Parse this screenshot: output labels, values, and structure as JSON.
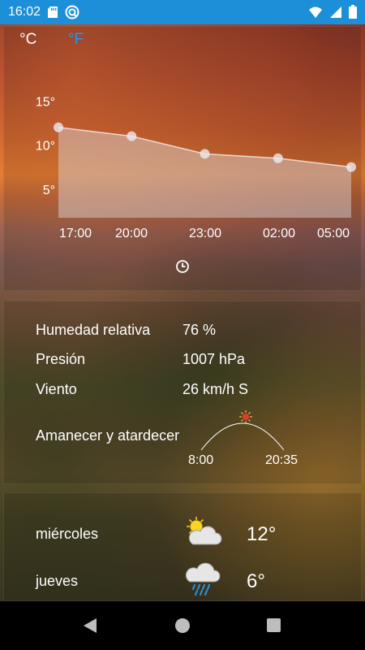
{
  "status_bar": {
    "time": "16:02"
  },
  "units": {
    "celsius": "°C",
    "fahrenheit": "°F",
    "selected": "celsius"
  },
  "chart_data": {
    "type": "area",
    "x": [
      "17:00",
      "20:00",
      "23:00",
      "02:00",
      "05:00"
    ],
    "series": [
      {
        "values": [
          12,
          11,
          9,
          8.5,
          7.5
        ]
      }
    ],
    "y_ticks": [
      "15°",
      "10°",
      "5°"
    ],
    "ylim": [
      0,
      15
    ],
    "grid": false
  },
  "details": {
    "humidity_label": "Humedad relativa",
    "humidity_value": "76 %",
    "pressure_label": "Presión",
    "pressure_value": "1007 hPa",
    "wind_label": "Viento",
    "wind_value": "26 km/h S",
    "sun_label": "Amanecer y atardecer",
    "sunrise": "8:00",
    "sunset": "20:35"
  },
  "forecast": [
    {
      "day": "miércoles",
      "temp": "12°",
      "icon": "sun-cloud-icon"
    },
    {
      "day": "jueves",
      "temp": "6°",
      "icon": "rain-cloud-icon"
    }
  ],
  "colors": {
    "accent": "#2196f3",
    "status_bar": "#1d8fd8",
    "sun": "#e53935"
  }
}
